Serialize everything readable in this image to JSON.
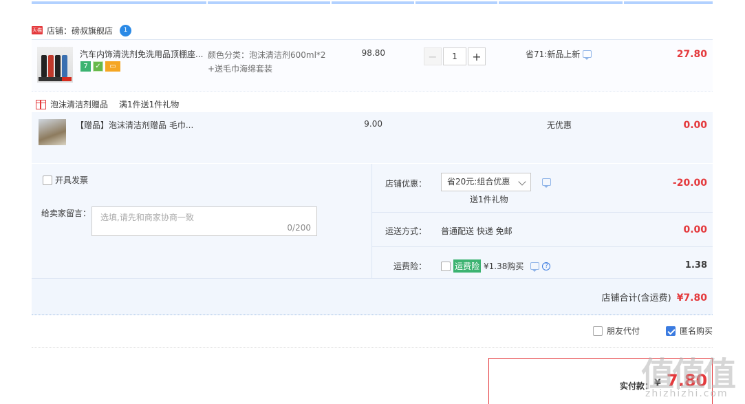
{
  "shop": {
    "name": "店铺：磅叔旗舰店",
    "tmall_badge": "天猫",
    "wangwang_badge": "1"
  },
  "item": {
    "title": "汽车内饰清洗剂免洗用品顶棚座...",
    "sku_line1": "颜色分类：泡沫清洁剂600ml*2",
    "sku_line2": "+送毛巾海绵套装",
    "unit_price": "98.80",
    "quantity": "1",
    "qty_minus": "−",
    "qty_plus": "+",
    "promo": "省71:新品上新",
    "subtotal": "27.80",
    "badges": [
      "7",
      "shield",
      "card"
    ]
  },
  "gift_section": {
    "label": "泡沫清洁剂赠品",
    "rule": "满1件送1件礼物",
    "title": "【赠品】泡沫清洁剂赠品 毛巾...",
    "unit_price": "9.00",
    "promo": "无优惠",
    "subtotal": "0.00"
  },
  "summary": {
    "invoice_label": "开具发票",
    "note_label": "给卖家留言：",
    "note_placeholder": "选填,请先和商家协商一致",
    "note_count": "0/200",
    "discount_label": "店铺优惠：",
    "discount_selected": "省20元:组合优惠",
    "discount_gift": "送1件礼物",
    "discount_value": "-20.00",
    "shipping_label": "运送方式：",
    "shipping_value": "普通配送 快递 免邮",
    "shipping_cost": "0.00",
    "insurance_label": "运费险：",
    "insurance_tag": "运费险",
    "insurance_text": "¥1.38购买",
    "insurance_help": "?",
    "insurance_cost": "1.38",
    "shop_total_label": "店铺合计(含运费)",
    "shop_total_value": "¥7.80"
  },
  "options": {
    "friend_pay": "朋友代付",
    "anonymous": "匿名购买",
    "anonymous_checked": true
  },
  "payment": {
    "label": "实付款：",
    "currency": "¥",
    "amount": "7.80"
  },
  "watermark": {
    "big": "值值值",
    "small": "zhizhizhi.com"
  },
  "colors": {
    "price_red": "#e4393c",
    "accent_blue": "#3b7be0",
    "row_bg": "#f3f7fd",
    "green_tag": "#3cb371"
  }
}
